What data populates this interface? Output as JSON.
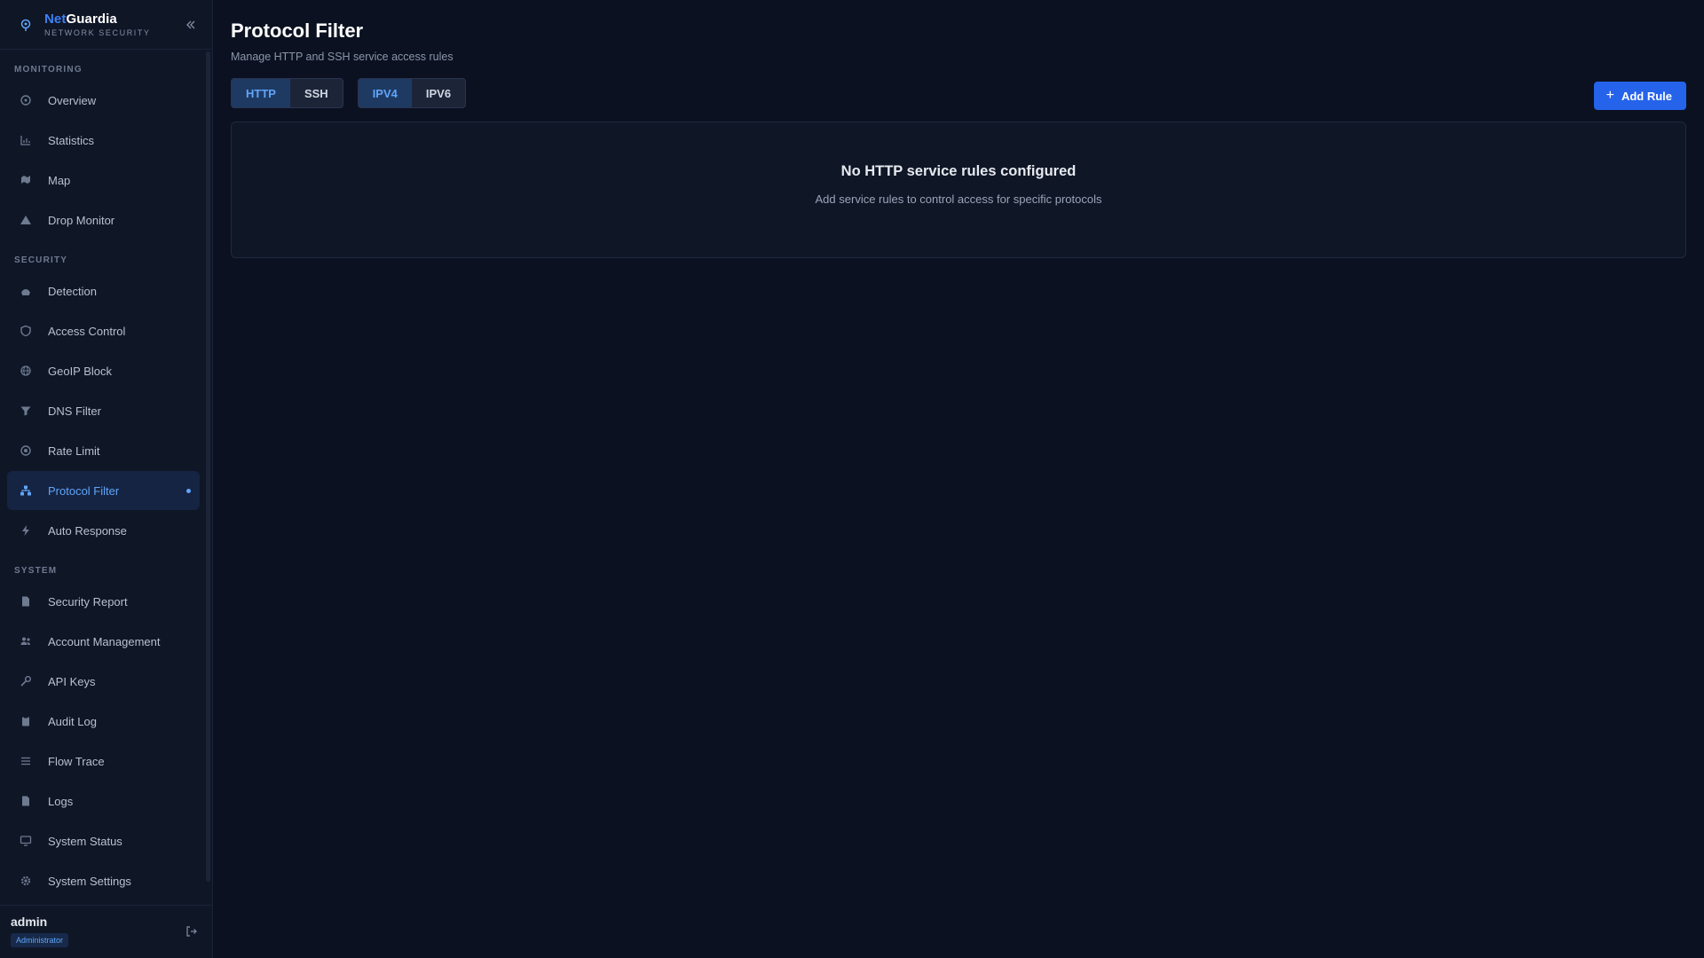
{
  "brand": {
    "name_accent": "Net",
    "name_rest": "Guardia",
    "subtitle": "NETWORK SECURITY"
  },
  "sidebar": {
    "sections": [
      {
        "label": "MONITORING",
        "items": [
          {
            "label": "Overview",
            "icon": "dashboard-icon"
          },
          {
            "label": "Statistics",
            "icon": "chart-icon"
          },
          {
            "label": "Map",
            "icon": "map-icon"
          },
          {
            "label": "Drop Monitor",
            "icon": "warning-icon"
          }
        ]
      },
      {
        "label": "SECURITY",
        "items": [
          {
            "label": "Detection",
            "icon": "radar-icon"
          },
          {
            "label": "Access Control",
            "icon": "shield-icon"
          },
          {
            "label": "GeoIP Block",
            "icon": "globe-icon"
          },
          {
            "label": "DNS Filter",
            "icon": "filter-icon"
          },
          {
            "label": "Rate Limit",
            "icon": "gauge-icon"
          },
          {
            "label": "Protocol Filter",
            "icon": "network-icon",
            "active": true
          },
          {
            "label": "Auto Response",
            "icon": "bolt-icon"
          }
        ]
      },
      {
        "label": "SYSTEM",
        "items": [
          {
            "label": "Security Report",
            "icon": "document-icon"
          },
          {
            "label": "Account Management",
            "icon": "users-icon"
          },
          {
            "label": "API Keys",
            "icon": "key-icon"
          },
          {
            "label": "Audit Log",
            "icon": "clipboard-icon"
          },
          {
            "label": "Flow Trace",
            "icon": "list-icon"
          },
          {
            "label": "Logs",
            "icon": "file-icon"
          },
          {
            "label": "System Status",
            "icon": "monitor-icon"
          },
          {
            "label": "System Settings",
            "icon": "gear-icon"
          }
        ]
      }
    ]
  },
  "user": {
    "name": "admin",
    "role": "Administrator"
  },
  "main": {
    "title": "Protocol Filter",
    "subtitle": "Manage HTTP and SSH service access rules",
    "protocol_tabs": [
      {
        "label": "HTTP",
        "selected": true
      },
      {
        "label": "SSH",
        "selected": false
      }
    ],
    "ip_tabs": [
      {
        "label": "IPV4",
        "selected": true
      },
      {
        "label": "IPV6",
        "selected": false
      }
    ],
    "add_button": "Add Rule",
    "empty_title": "No HTTP service rules configured",
    "empty_subtitle": "Add service rules to control access for specific protocols"
  },
  "colors": {
    "accent": "#3b82f6",
    "background": "#0b1120",
    "sidebar": "#0f1626"
  }
}
